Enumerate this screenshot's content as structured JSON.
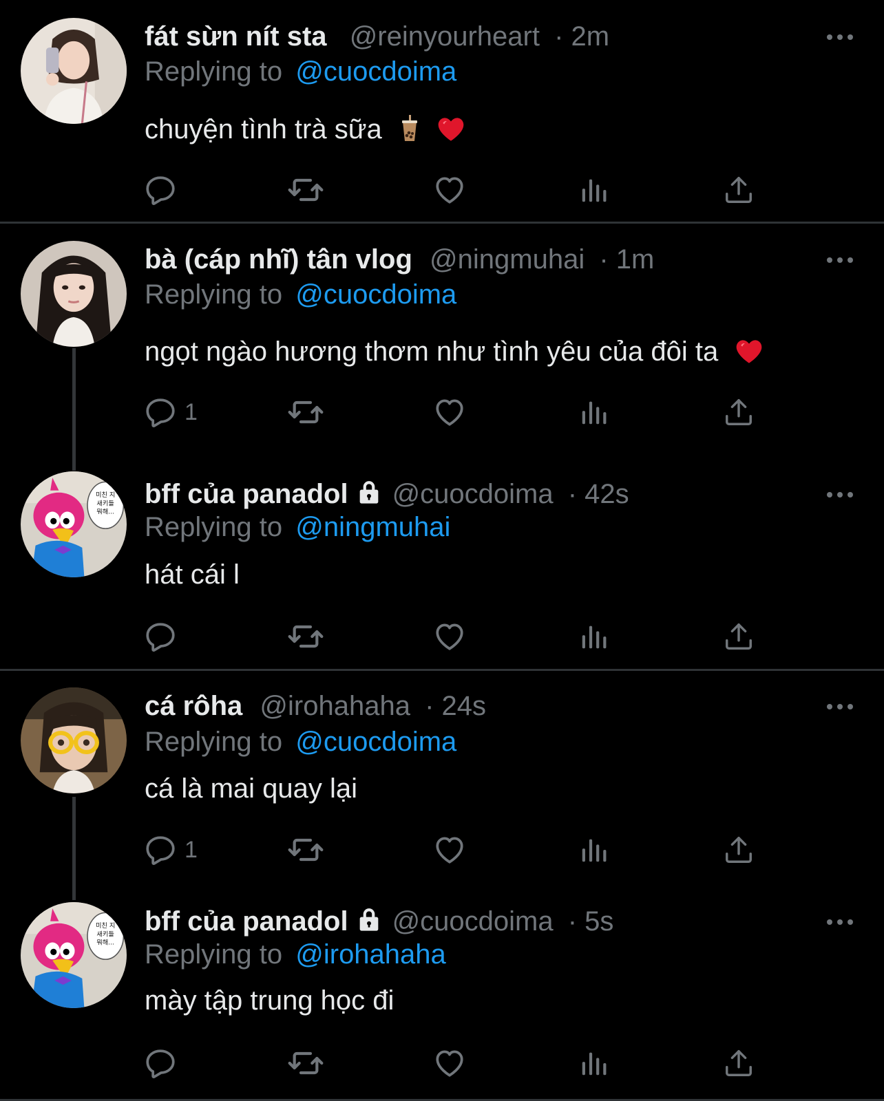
{
  "colors": {
    "background": "#000000",
    "primary_text": "#e7e9ea",
    "secondary_text": "#71767b",
    "mention": "#1d9bf0",
    "divider": "#2f3336",
    "heart": "#e0162b"
  },
  "icons": {
    "reply": "reply-bubble-icon",
    "retweet": "retweet-icon",
    "like": "heart-icon",
    "views": "analytics-icon",
    "share": "share-icon",
    "more": "more-dots-icon",
    "protected": "lock-icon"
  },
  "replying_label": "Replying to",
  "tweets": [
    {
      "name": "fát sừn nít sta",
      "handle": "@reinyourheart",
      "time": "· 2m",
      "reply_to": "@cuocdoima",
      "text": "chuyện tình trà sữa",
      "emojis": [
        "bubble-tea",
        "red-heart"
      ],
      "reply_count": "",
      "protected": false
    },
    {
      "name": "bà (cáp nhĩ) tân vlog",
      "handle": "@ningmuhai",
      "time": "· 1m",
      "reply_to": "@cuocdoima",
      "text": "ngọt ngào hương thơm như tình yêu của đôi ta",
      "emojis": [
        "red-heart"
      ],
      "reply_count": "1",
      "protected": false
    },
    {
      "name": "bff của panadol",
      "handle": "@cuocdoima",
      "time": "· 42s",
      "reply_to": "@ningmuhai",
      "text": "hát cái l",
      "emojis": [],
      "reply_count": "",
      "protected": true
    },
    {
      "name": "cá rôha",
      "handle": "@irohahaha",
      "time": "· 24s",
      "reply_to": "@cuocdoima",
      "text": "cá là mai quay lại",
      "emojis": [],
      "reply_count": "1",
      "protected": false
    },
    {
      "name": "bff của panadol",
      "handle": "@cuocdoima",
      "time": "· 5s",
      "reply_to": "@irohahaha",
      "text": "mày tập trung học đi",
      "emojis": [],
      "reply_count": "",
      "protected": true
    }
  ],
  "avatar_sticker_text": "미친 지\n새키들\n뭐해..."
}
